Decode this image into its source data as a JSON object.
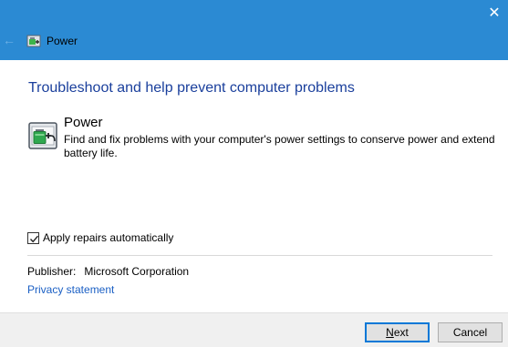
{
  "window": {
    "title": "Power",
    "close_glyph": "✕",
    "back_glyph": "←",
    "title_icon": "power-troubleshooter-icon",
    "accent_color": "#2b8ad3"
  },
  "main": {
    "heading": "Troubleshoot and help prevent computer problems",
    "item": {
      "icon": "battery-plug-icon",
      "title": "Power",
      "description": "Find and fix problems with your computer's power settings to conserve power and extend battery life."
    },
    "apply_repairs": {
      "label": "Apply repairs automatically",
      "checked": true
    },
    "publisher": {
      "label": "Publisher:",
      "value": "Microsoft Corporation"
    },
    "privacy_link": "Privacy statement"
  },
  "footer": {
    "next_mnemonic": "N",
    "next_rest": "ext",
    "cancel_label": "Cancel"
  }
}
